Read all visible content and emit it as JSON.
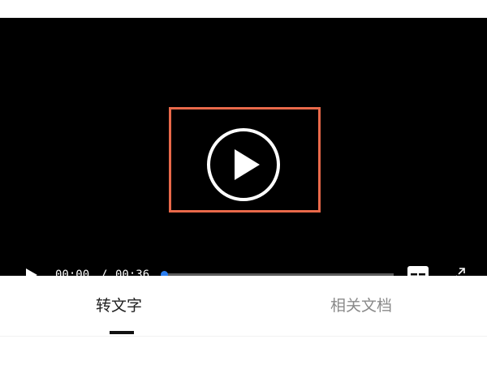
{
  "player": {
    "current_time": "00:00",
    "separator": "/",
    "total_time": "00:36",
    "progress": 0,
    "accent_color": "#2a7ef0",
    "highlight_color": "#e9694a",
    "icons": {
      "big_play": "play-circle-icon",
      "play": "play-icon",
      "subtitle": "subtitle-icon",
      "fullscreen": "fullscreen-icon"
    }
  },
  "tabs": [
    {
      "label": "转文字",
      "active": true
    },
    {
      "label": "相关文档",
      "active": false
    }
  ]
}
